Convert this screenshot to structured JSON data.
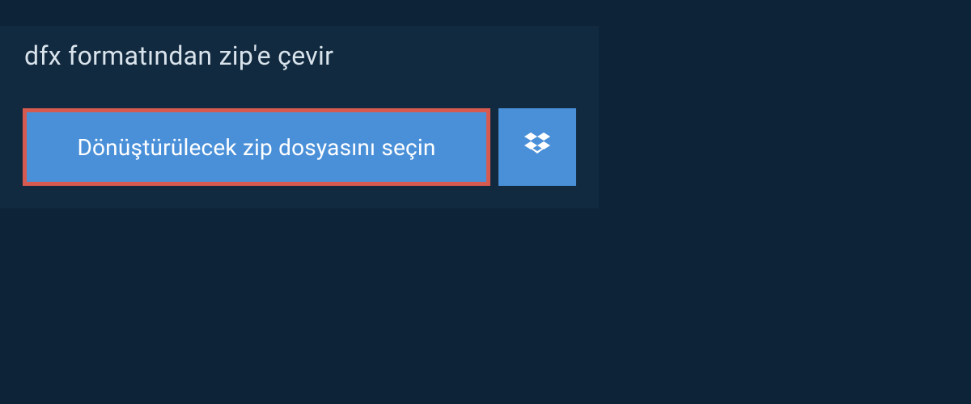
{
  "header": {
    "title": "dfx formatından zip'e çevir"
  },
  "upload": {
    "choose_label": "Dönüştürülecek zip dosyasını seçin"
  },
  "colors": {
    "page_bg": "#0d2438",
    "panel_bg": "#122a3f",
    "button_bg": "#4a90d9",
    "button_border": "#d65a4f",
    "text_light": "#d9e3ec",
    "text_white": "#ffffff"
  }
}
